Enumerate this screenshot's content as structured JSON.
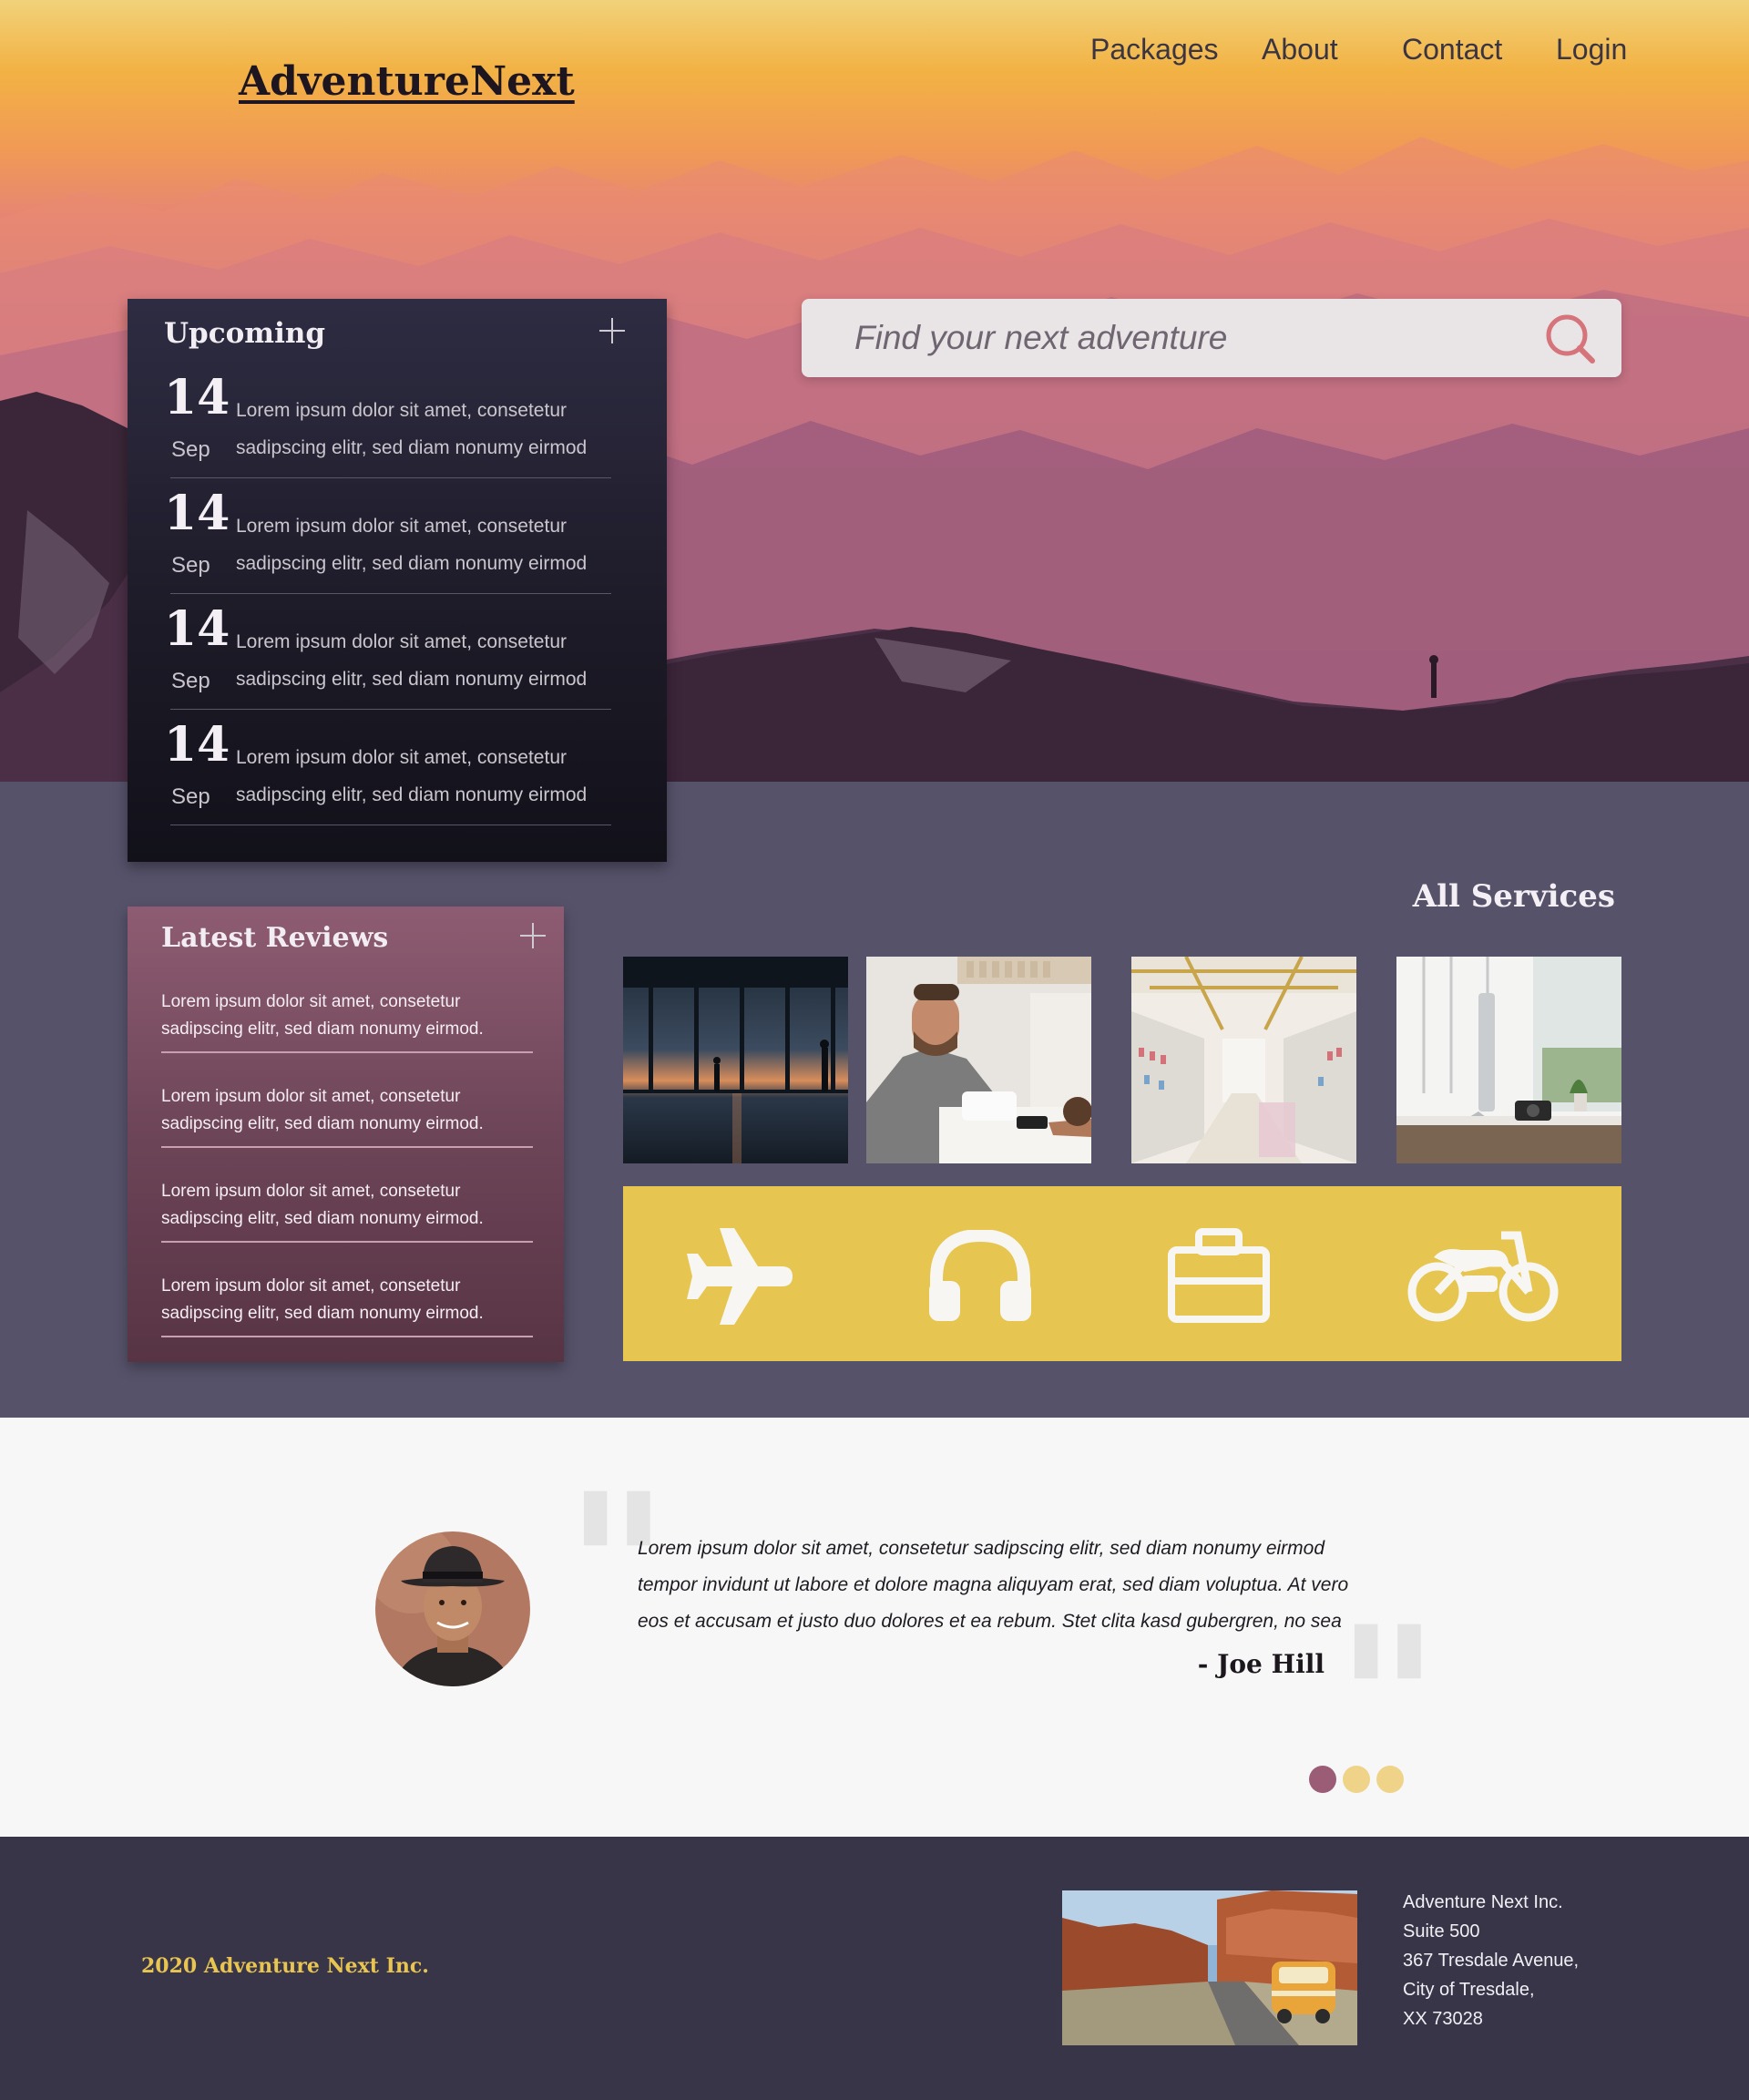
{
  "brand": {
    "logo": "AdventureNext"
  },
  "nav": {
    "items": [
      "Packages",
      "About",
      "Contact",
      "Login"
    ]
  },
  "search": {
    "placeholder": "Find your next adventure"
  },
  "upcoming": {
    "title": "Upcoming",
    "events": [
      {
        "day": "14",
        "month": "Sep",
        "line1": "Lorem ipsum dolor sit amet, consetetur",
        "line2": "sadipscing elitr, sed diam nonumy eirmod"
      },
      {
        "day": "14",
        "month": "Sep",
        "line1": "Lorem ipsum dolor sit amet, consetetur",
        "line2": "sadipscing elitr, sed diam nonumy eirmod"
      },
      {
        "day": "14",
        "month": "Sep",
        "line1": "Lorem ipsum dolor sit amet, consetetur",
        "line2": "sadipscing elitr, sed diam nonumy eirmod"
      },
      {
        "day": "14",
        "month": "Sep",
        "line1": "Lorem ipsum dolor sit amet, consetetur",
        "line2": "sadipscing elitr, sed diam nonumy eirmod"
      }
    ]
  },
  "reviews": {
    "title": "Latest Reviews",
    "items": [
      {
        "line1": "Lorem ipsum dolor sit amet, consetetur",
        "line2": "sadipscing elitr, sed diam nonumy eirmod."
      },
      {
        "line1": "Lorem ipsum dolor sit amet, consetetur",
        "line2": "sadipscing elitr, sed diam nonumy eirmod."
      },
      {
        "line1": "Lorem ipsum dolor sit amet, consetetur",
        "line2": "sadipscing elitr, sed diam nonumy eirmod."
      },
      {
        "line1": "Lorem ipsum dolor sit amet, consetetur",
        "line2": "sadipscing elitr, sed diam nonumy eirmod."
      }
    ]
  },
  "services": {
    "title": "All Services",
    "photos": [
      "airport-photo",
      "checkout-photo",
      "store-photo",
      "desk-photo"
    ],
    "icons": [
      "airplane-icon",
      "headphones-icon",
      "briefcase-icon",
      "motorcycle-icon"
    ]
  },
  "testimonial": {
    "line1": "Lorem ipsum dolor sit amet, consetetur sadipscing elitr, sed diam nonumy eirmod",
    "line2": "tempor invidunt ut labore et dolore magna aliquyam erat, sed diam voluptua. At vero",
    "line3": "eos et accusam et justo duo dolores et ea rebum. Stet clita kasd gubergren, no sea",
    "author": "- Joe Hill",
    "active_slide": 1,
    "slide_count": 3
  },
  "footer": {
    "copyright": "2020 Adventure Next Inc.",
    "address": [
      "Adventure Next Inc.",
      "Suite 500",
      "367 Tresdale Avenue,",
      "City of Tresdale,",
      "XX 73028"
    ]
  },
  "colors": {
    "accent_yellow": "#e6c651",
    "dot_active": "#9b5d76",
    "dot_inactive": "#efd388",
    "panel_dark": "#1c1a26",
    "panel_rose": "#6d4558",
    "section_bg": "#56526a",
    "footer_bg": "#383548"
  }
}
